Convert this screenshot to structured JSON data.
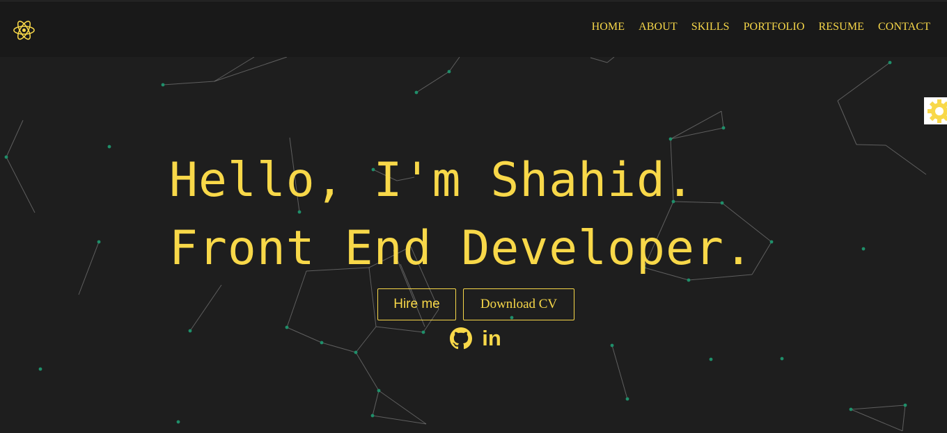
{
  "nav": {
    "logo_icon": "atom-icon",
    "links": [
      "HOME",
      "ABOUT",
      "SKILLS",
      "PORTFOLIO",
      "RESUME",
      "CONTACT"
    ]
  },
  "hero": {
    "line1": "Hello, I'm Shahid.",
    "line2": "Front End Developer.",
    "hire_label": "Hire me",
    "cv_label": "Download CV"
  },
  "socials": {
    "github_icon": "github-icon",
    "linkedin_text": "in"
  },
  "settings_icon": "gear-icon",
  "colors": {
    "accent": "#f8d849",
    "background": "#1e1e1e",
    "navbar": "#191919",
    "particle_dot": "#1f8f6a",
    "particle_line": "#9a9a9a"
  }
}
